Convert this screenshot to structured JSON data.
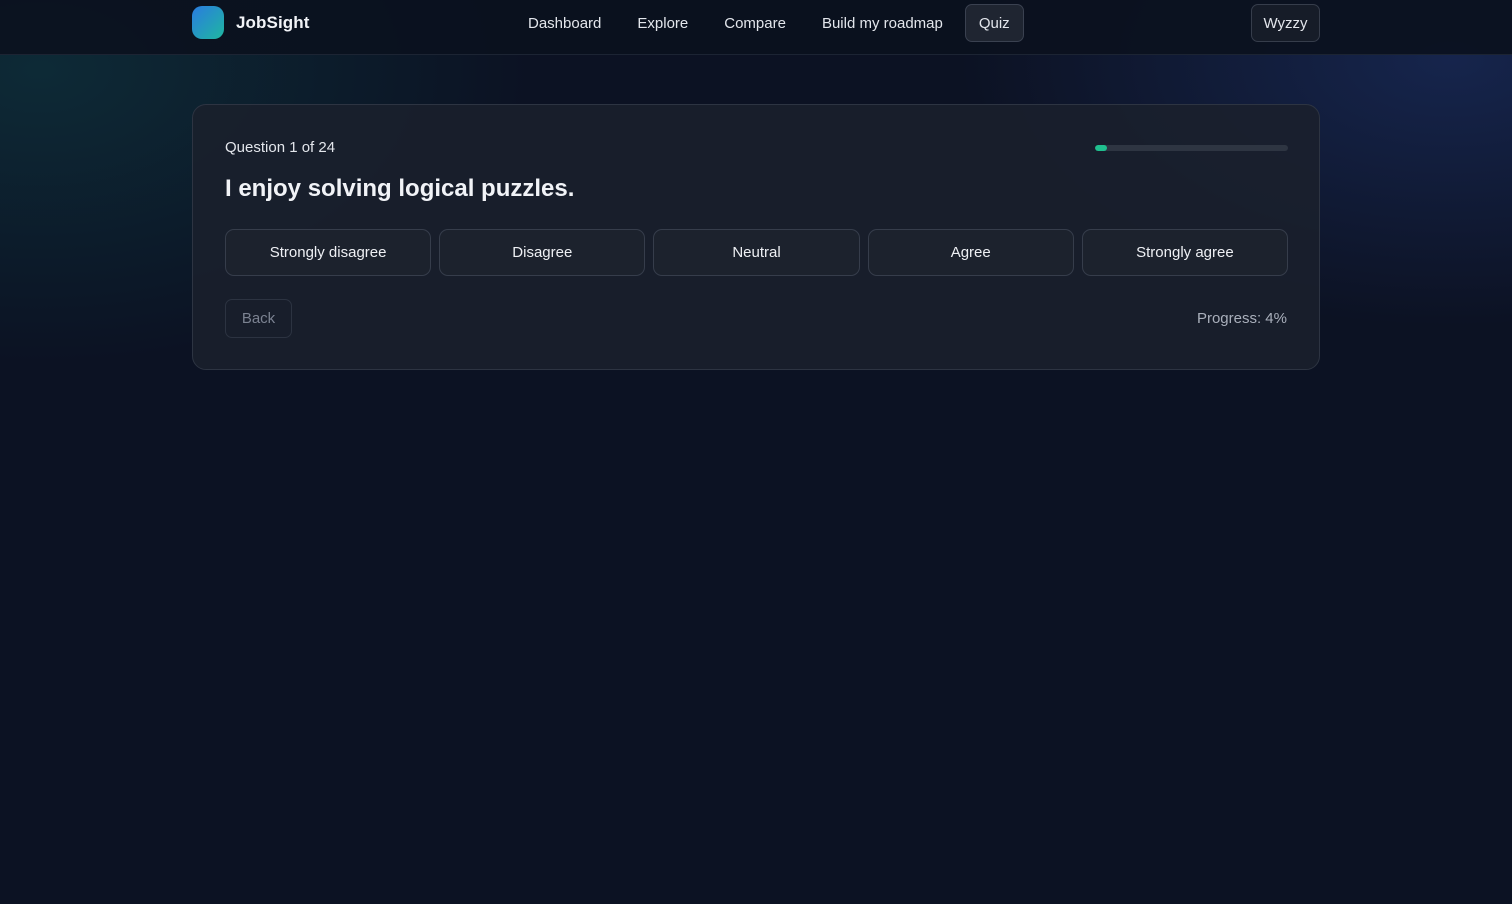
{
  "app": {
    "name": "JobSight",
    "logo_icon": "gradient-square-logo",
    "accent": "#1fbf8e"
  },
  "nav": {
    "items": [
      {
        "label": "Dashboard",
        "active": false
      },
      {
        "label": "Explore",
        "active": false
      },
      {
        "label": "Compare",
        "active": false
      },
      {
        "label": "Build my roadmap",
        "active": false
      },
      {
        "label": "Quiz",
        "active": true
      }
    ]
  },
  "user": {
    "name": "Wyzzy"
  },
  "quiz": {
    "counter": "Question 1 of 24",
    "question": "I enjoy solving logical puzzles.",
    "answers": [
      "Strongly disagree",
      "Disagree",
      "Neutral",
      "Agree",
      "Strongly agree"
    ],
    "back_label": "Back",
    "progress_text": "Progress: 4%",
    "progress_percent": 4
  }
}
